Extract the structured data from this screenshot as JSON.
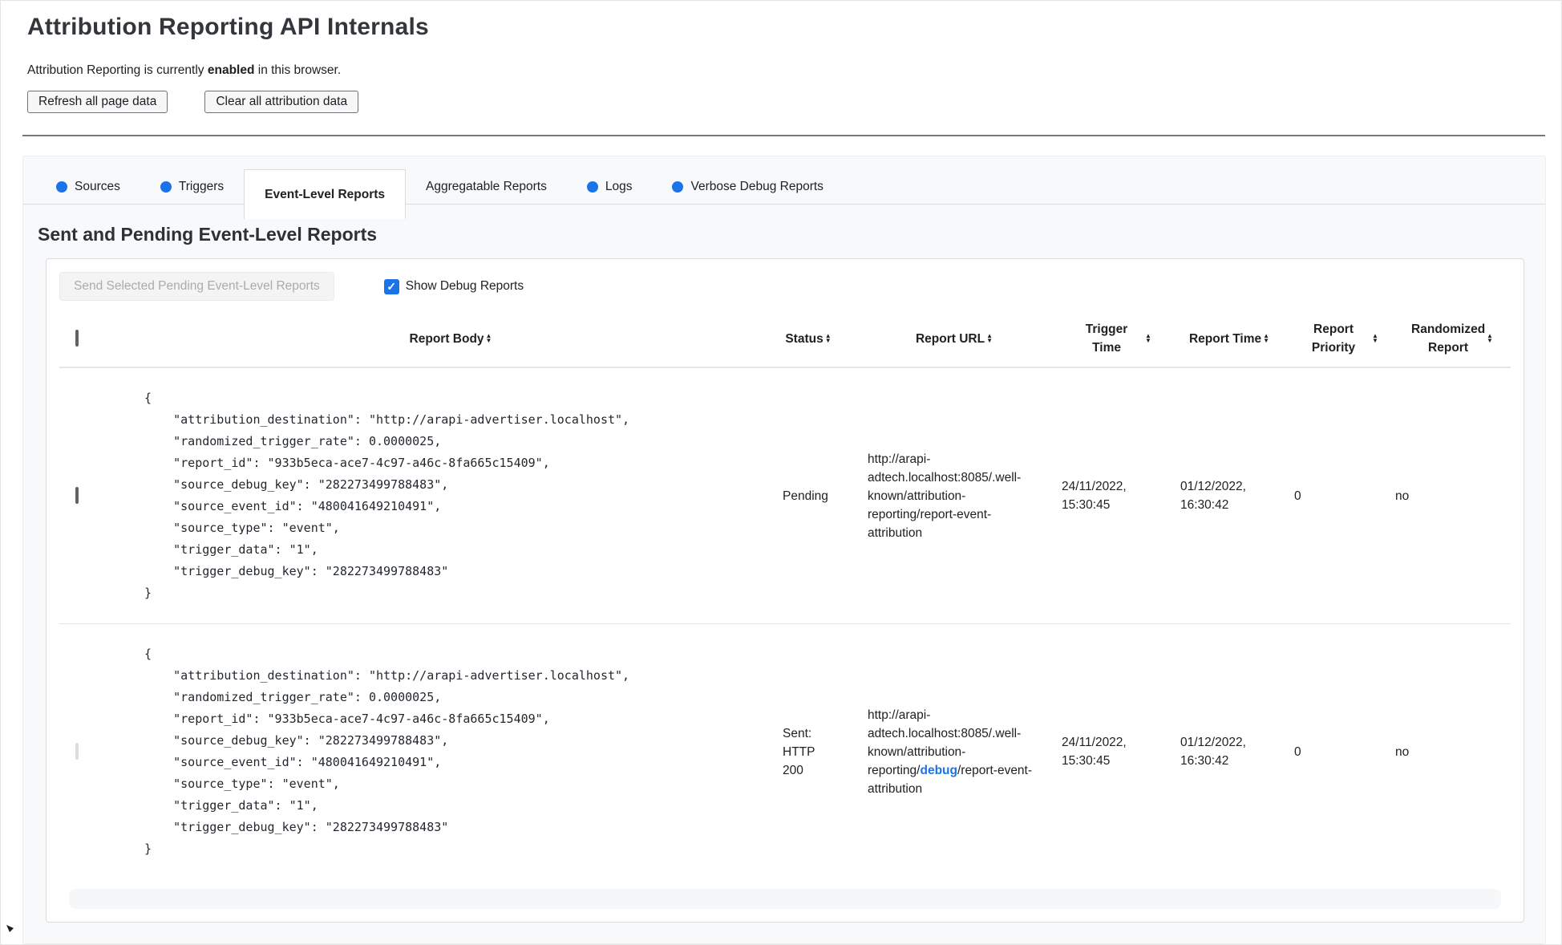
{
  "header": {
    "title": "Attribution Reporting API Internals",
    "status_prefix": "Attribution Reporting is currently ",
    "status_bold": "enabled",
    "status_suffix": " in this browser.",
    "refresh_button": "Refresh all page data",
    "clear_button": "Clear all attribution data"
  },
  "tabs": [
    {
      "label": "Sources",
      "has_dot": true,
      "active": false
    },
    {
      "label": "Triggers",
      "has_dot": true,
      "active": false
    },
    {
      "label": "Event-Level Reports",
      "has_dot": false,
      "active": true
    },
    {
      "label": "Aggregatable Reports",
      "has_dot": false,
      "active": false
    },
    {
      "label": "Logs",
      "has_dot": true,
      "active": false
    },
    {
      "label": "Verbose Debug Reports",
      "has_dot": true,
      "active": false
    }
  ],
  "section": {
    "heading": "Sent and Pending Event-Level Reports",
    "send_button": "Send Selected Pending Event-Level Reports",
    "send_button_enabled": false,
    "show_debug_label": "Show Debug Reports",
    "show_debug_checked": true
  },
  "icons": {
    "sort_up": "▲",
    "sort_down": "▼",
    "check": "✓"
  },
  "colors": {
    "accent_blue": "#1a73e8",
    "panel_border": "#dadce0",
    "wrapper_bg": "#f8f9fa"
  },
  "table": {
    "columns": [
      "Report Body",
      "Status",
      "Report URL",
      "Trigger Time",
      "Report Time",
      "Report Priority",
      "Randomized Report"
    ],
    "rows": [
      {
        "selectable": true,
        "checked": false,
        "report_body": "{\n    \"attribution_destination\": \"http://arapi-advertiser.localhost\",\n    \"randomized_trigger_rate\": 0.0000025,\n    \"report_id\": \"933b5eca-ace7-4c97-a46c-8fa665c15409\",\n    \"source_debug_key\": \"282273499788483\",\n    \"source_event_id\": \"480041649210491\",\n    \"source_type\": \"event\",\n    \"trigger_data\": \"1\",\n    \"trigger_debug_key\": \"282273499788483\"\n}",
        "status": "Pending",
        "url_prefix": "http://arapi-adtech.localhost:8085/.well-known/attribution-reporting/report-event-attribution",
        "url_debug": "",
        "url_suffix": "",
        "trigger_time": "24/11/2022, 15:30:45",
        "report_time": "01/12/2022, 16:30:42",
        "report_priority": "0",
        "randomized_report": "no"
      },
      {
        "selectable": false,
        "checked": false,
        "report_body": "{\n    \"attribution_destination\": \"http://arapi-advertiser.localhost\",\n    \"randomized_trigger_rate\": 0.0000025,\n    \"report_id\": \"933b5eca-ace7-4c97-a46c-8fa665c15409\",\n    \"source_debug_key\": \"282273499788483\",\n    \"source_event_id\": \"480041649210491\",\n    \"source_type\": \"event\",\n    \"trigger_data\": \"1\",\n    \"trigger_debug_key\": \"282273499788483\"\n}",
        "status": "Sent: HTTP 200",
        "url_prefix": "http://arapi-adtech.localhost:8085/.well-known/attribution-reporting/",
        "url_debug": "debug",
        "url_suffix": "/report-event-attribution",
        "trigger_time": "24/11/2022, 15:30:45",
        "report_time": "01/12/2022, 16:30:42",
        "report_priority": "0",
        "randomized_report": "no"
      }
    ]
  }
}
